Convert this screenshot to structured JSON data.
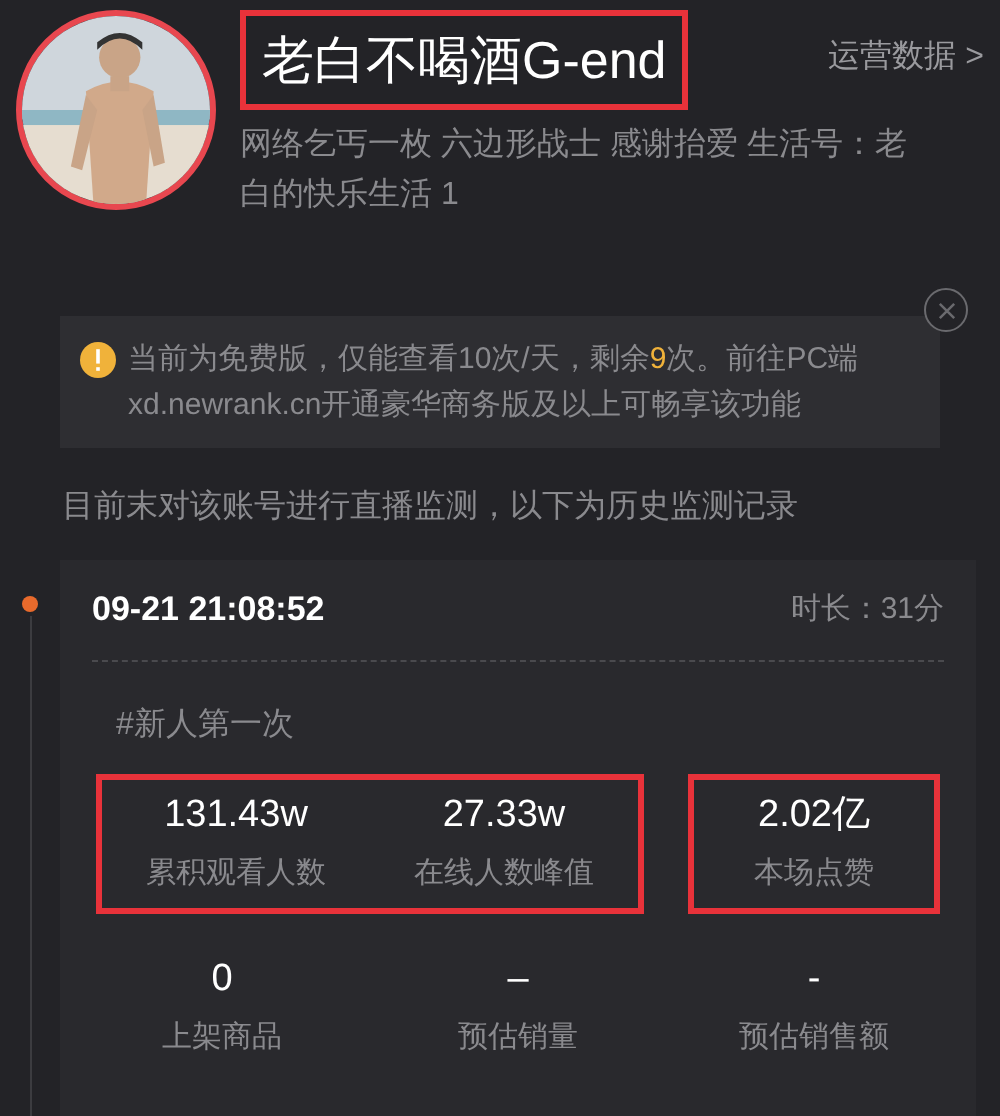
{
  "profile": {
    "name": "老白不喝酒G-end",
    "name_highlighted": true,
    "ops_link": "运营数据 >",
    "bio": "网络乞丐一枚 六边形战士 感谢抬爱 生活号：老白的快乐生活 1"
  },
  "notice": {
    "parts": [
      {
        "text": "当前为免费版，仅能查看10次/天，剩余",
        "accent": false
      },
      {
        "text": "9",
        "accent": true
      },
      {
        "text": "次。前往PC端 xd.newrank.cn开通豪华商务版及以上可畅享该功能",
        "accent": false
      }
    ]
  },
  "status_text": "目前末对该账号进行直播监测，以下为历史监测记录",
  "record": {
    "time": "09-21 21:08:52",
    "duration": "时长：31分",
    "tag": "#新人第一次",
    "stat_rows": [
      {
        "groups": [
          {
            "highlighted": true,
            "stats": [
              {
                "value": "131.43w",
                "label": "累积观看人数"
              },
              {
                "value": "27.33w",
                "label": "在线人数峰值"
              }
            ]
          },
          {
            "highlighted": true,
            "stats": [
              {
                "value": "2.02亿",
                "label": "本场点赞"
              }
            ]
          }
        ]
      },
      {
        "groups": [
          {
            "highlighted": false,
            "stats": [
              {
                "value": "0",
                "label": "上架商品"
              }
            ]
          },
          {
            "highlighted": false,
            "stats": [
              {
                "value": "–",
                "label": "预估销量"
              }
            ]
          },
          {
            "highlighted": false,
            "stats": [
              {
                "value": "-",
                "label": "预估销售额"
              }
            ]
          }
        ]
      }
    ]
  }
}
